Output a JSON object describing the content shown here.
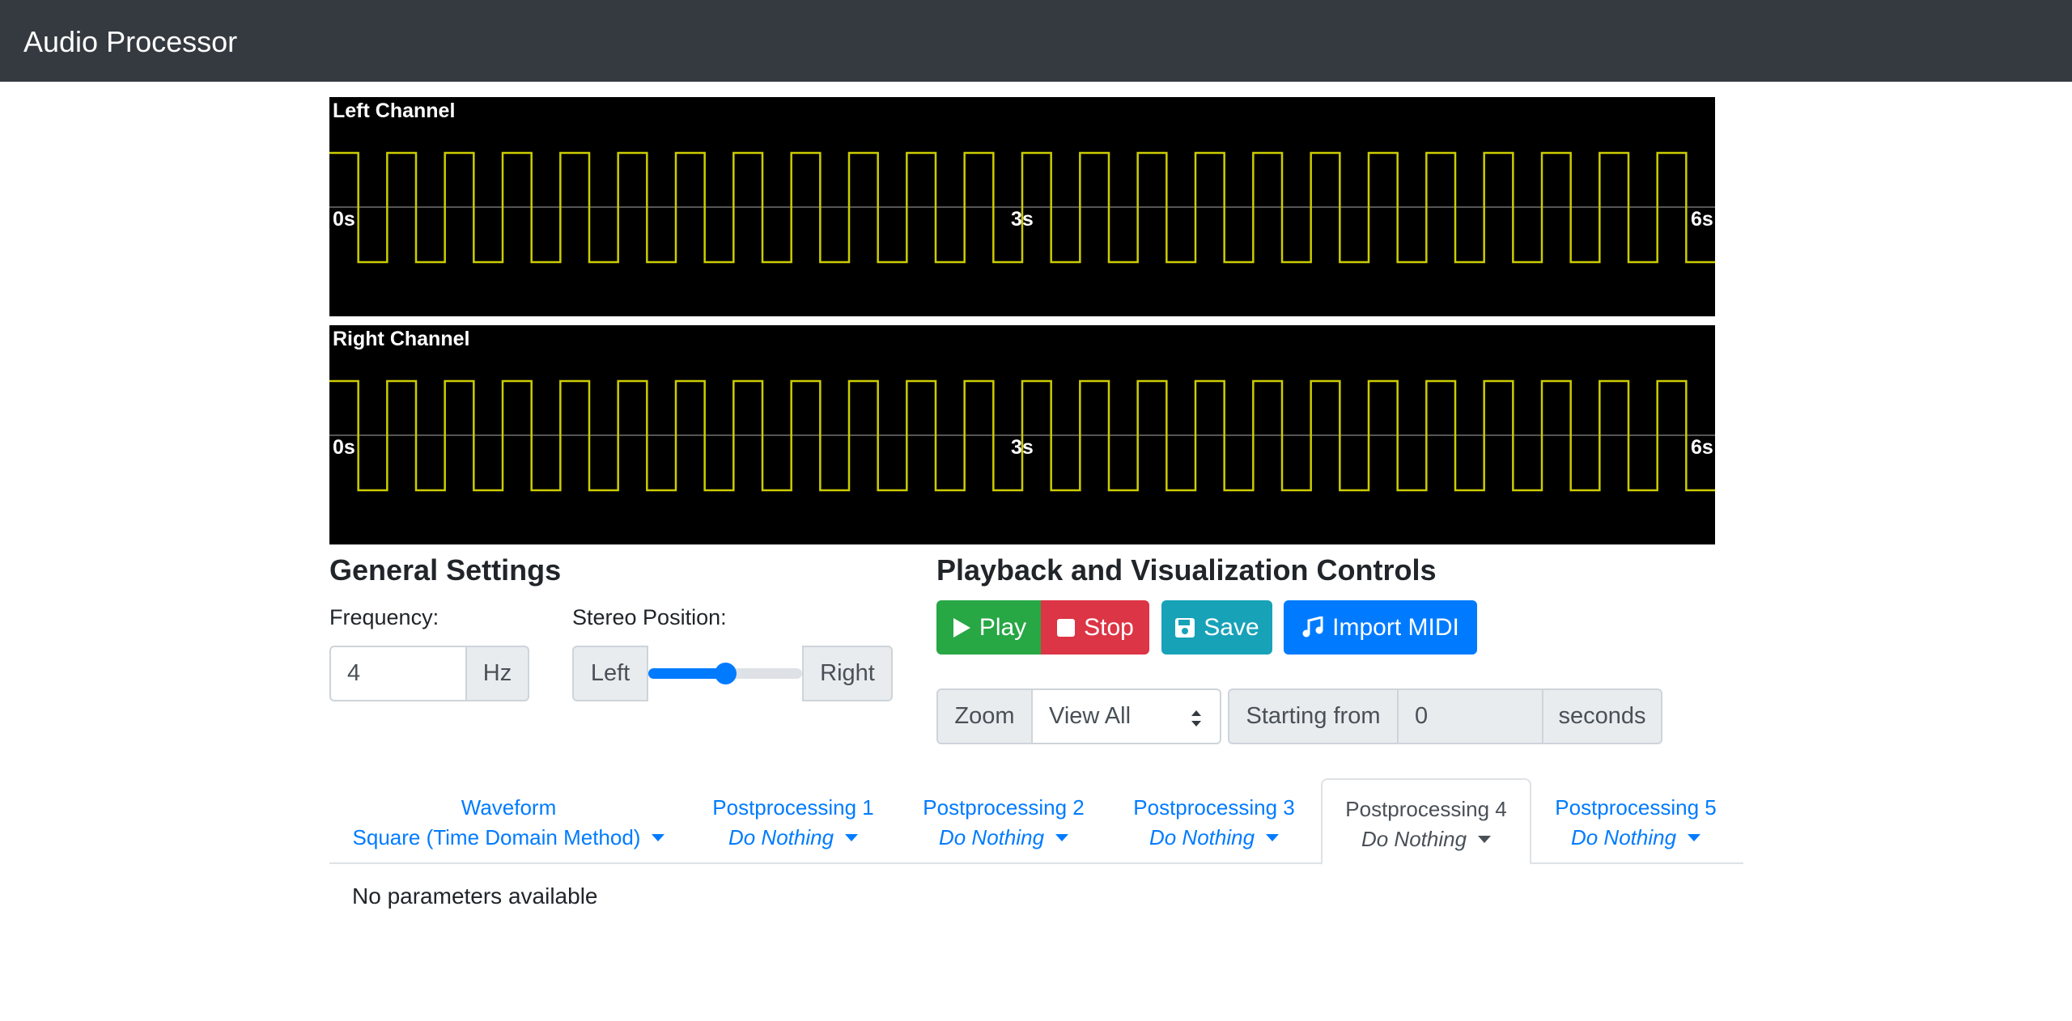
{
  "navbar": {
    "title": "Audio Processor"
  },
  "scopes": {
    "left": {
      "label": "Left Channel",
      "ticks": [
        "0s",
        "3s",
        "6s"
      ]
    },
    "right": {
      "label": "Right Channel",
      "ticks": [
        "0s",
        "3s",
        "6s"
      ]
    },
    "duration_seconds": 6,
    "frequency_hz": 4,
    "waveform_color": "#cccc00"
  },
  "general_settings": {
    "heading": "General Settings",
    "frequency_label": "Frequency:",
    "frequency_value": "4",
    "frequency_unit": "Hz",
    "stereo_label": "Stereo Position:",
    "stereo_left": "Left",
    "stereo_right": "Right",
    "stereo_value_fraction": 0.5
  },
  "playback": {
    "heading": "Playback and Visualization Controls",
    "play_label": "Play",
    "stop_label": "Stop",
    "save_label": "Save",
    "import_label": "Import MIDI",
    "zoom_label": "Zoom",
    "zoom_value": "View All",
    "starting_from_label": "Starting from",
    "starting_from_value": "0",
    "seconds_label": "seconds"
  },
  "tabs": [
    {
      "title": "Waveform",
      "value": "Square (Time Domain Method)"
    },
    {
      "title": "Postprocessing 1",
      "value": "Do Nothing"
    },
    {
      "title": "Postprocessing 2",
      "value": "Do Nothing"
    },
    {
      "title": "Postprocessing 3",
      "value": "Do Nothing"
    },
    {
      "title": "Postprocessing 4",
      "value": "Do Nothing"
    },
    {
      "title": "Postprocessing 5",
      "value": "Do Nothing"
    }
  ],
  "active_tab": "Postprocessing 4",
  "tab_content": {
    "message": "No parameters available"
  },
  "colors": {
    "navbar": "#343a40",
    "play": "#28a745",
    "stop": "#dc3545",
    "save": "#17a2b8",
    "import": "#007bff",
    "link": "#007bff"
  }
}
